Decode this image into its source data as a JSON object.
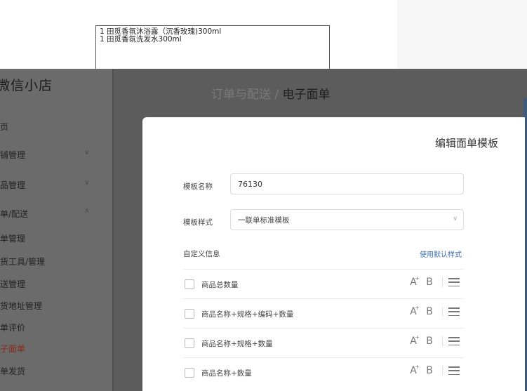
{
  "preview": {
    "lines": [
      "1 田觅香氛沐浴露（沉香玫瑰)300ml",
      "1 田觅香氛洗发水300ml"
    ]
  },
  "sidebar": {
    "brand": "微信小店",
    "items": [
      {
        "label": "首页",
        "expandable": false,
        "active": false
      },
      {
        "label": "店铺管理",
        "expandable": true,
        "expanded": false,
        "active": false
      },
      {
        "label": "商品管理",
        "expandable": true,
        "expanded": false,
        "active": false
      },
      {
        "label": "订单/配送",
        "expandable": true,
        "expanded": true,
        "active": false
      },
      {
        "label": "订单管理",
        "expandable": false,
        "active": false
      },
      {
        "label": "发货工具/管理",
        "expandable": false,
        "active": false
      },
      {
        "label": "配送管理",
        "expandable": false,
        "active": false
      },
      {
        "label": "退货地址管理",
        "expandable": false,
        "active": false
      },
      {
        "label": "订单评价",
        "expandable": false,
        "active": false
      },
      {
        "label": "电子面单",
        "expandable": false,
        "active": true
      },
      {
        "label": "订单发货",
        "expandable": false,
        "active": false
      }
    ]
  },
  "header": {
    "breadcrumb_parent": "订单与配送",
    "breadcrumb_sep": " / ",
    "breadcrumb_current": "电子面单"
  },
  "modal": {
    "title": "编辑面单模板",
    "template_name_label": "模板名称",
    "template_name_value": "76130",
    "template_style_label": "模板样式",
    "template_style_value": "一联单标准模板",
    "custom_info_label": "自定义信息",
    "use_default_link": "使用默认样式",
    "rows": [
      {
        "label": "商品总数量",
        "checked": false
      },
      {
        "label": "商品名称+规格+编码+数量",
        "checked": false
      },
      {
        "label": "商品名称+规格+数量",
        "checked": false
      },
      {
        "label": "商品名称+数量",
        "checked": false
      }
    ],
    "tools": {
      "font_size": "A",
      "font_size_sup": "+",
      "bold": "B"
    }
  },
  "colors": {
    "active_menu": "#8a2a1a",
    "link": "#3a6fb5",
    "overlay": "#5c5c5c"
  }
}
